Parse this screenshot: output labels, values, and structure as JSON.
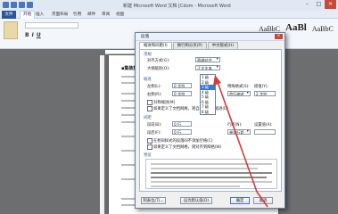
{
  "titlebar": {
    "title": "新建 Microsoft Word 文档 [Cdom - Microsoft Word"
  },
  "ribbon": {
    "tabs": [
      {
        "label": "文件"
      },
      {
        "label": "开始"
      },
      {
        "label": "插入"
      },
      {
        "label": "页面布局"
      },
      {
        "label": "引用"
      },
      {
        "label": "邮件"
      },
      {
        "label": "审阅"
      },
      {
        "label": "视图"
      }
    ],
    "format_buttons": [
      "B",
      "I",
      "U"
    ],
    "styles": [
      "AaBbC",
      "AaBl",
      "AaBbC"
    ]
  },
  "document": {
    "heading": "▪集装集装员管",
    "right_fragments": [
      "罕关于木"
    ]
  },
  "dialog": {
    "title": "段落",
    "close": "×",
    "tabs": [
      "缩进和间距(I)",
      "换行和分页(P)",
      "中文版式(H)"
    ],
    "general_header": "常规",
    "alignment_label": "对齐方式(G):",
    "alignment_value": "两端对齐",
    "outline_label": "大纲级别(O):",
    "outline_value": "正文文本",
    "outline_options": [
      "1 级",
      "2 级",
      "3 级",
      "4 级",
      "5 级",
      "6 级",
      "7 级",
      "8 级"
    ],
    "indent_header": "缩进",
    "left_label": "左侧(L):",
    "left_value": "0 字符",
    "right_label": "右侧(R):",
    "right_value": "0 字符",
    "special_label": "特殊格式(S):",
    "special_value": "首行缩进",
    "amount_label": "磅值(Y):",
    "amount_value": "2 字符",
    "mirror_indent": "对称缩进(M)",
    "auto_right": "如果定义了文档网格，则自动调整右缩进(D)",
    "spacing_header": "间距",
    "before_label": "段前(B):",
    "before_value": "0 行",
    "after_label": "段后(F):",
    "after_value": "0 行",
    "line_label": "行距(N):",
    "line_value": "单倍行距",
    "at_label": "设置值(A):",
    "no_space": "在相同样式的段落间不添加空格(C)",
    "snap_grid": "如果定义了文档网格，则对齐到网格(W)",
    "preview_header": "预览",
    "buttons": {
      "tabs": "制表位(T)...",
      "default": "设为默认值(D)",
      "ok": "确定",
      "cancel": "取消"
    }
  },
  "colors": {
    "accent": "#3a78d6",
    "arrow": "#d43b3b",
    "close": "#c9483c"
  }
}
